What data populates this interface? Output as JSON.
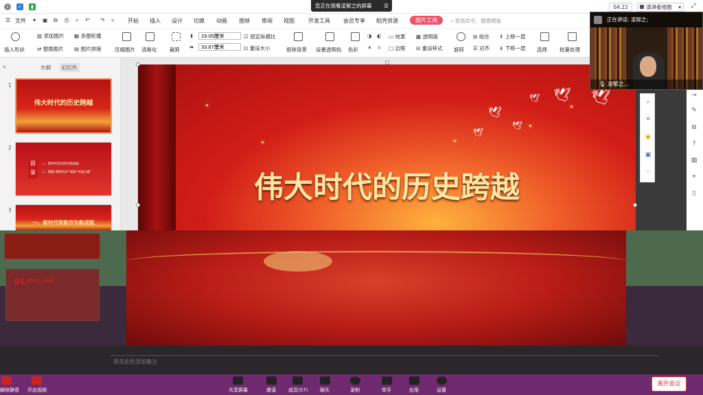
{
  "topbar": {
    "share_text": "您正在观看凌郁之的屏幕",
    "timer": "04:22",
    "presenter_view": "演讲者视图",
    "menu_icon": "menu-icon"
  },
  "menubar": {
    "file": "文件",
    "items": [
      "开始",
      "插入",
      "设计",
      "切换",
      "动画",
      "放映",
      "审阅",
      "视图",
      "开发工具",
      "会员专享",
      "稻壳资源"
    ],
    "active_tab": "图片工具",
    "search_placeholder": "查找命令、搜索模板"
  },
  "ribbon": {
    "insert_shape": "插入形状",
    "add_picture": "添加图片",
    "replace_picture": "替换图片",
    "multi_outline": "多图轮播",
    "picture_stitch": "图片拼接",
    "compress": "压缩图片",
    "sharpen": "清晰化",
    "crop": "裁剪",
    "height": "19.05厘米",
    "width": "33.87厘米",
    "lock_ratio": "锁定纵横比",
    "reset_size": "重设大小",
    "remove_bg": "抠除背景",
    "set_transparent": "设置透明色",
    "color": "色彩",
    "effects": "效果",
    "transparency": "透明度",
    "border": "边框",
    "reset_style": "重设样式",
    "rotate": "旋转",
    "group": "组合",
    "align": "对齐",
    "bring_forward": "上移一层",
    "send_backward": "下移一层",
    "select": "选择",
    "batch": "批量处理"
  },
  "leftpane": {
    "tab_outline": "大纲",
    "tab_slides": "幻灯片",
    "thumbs": [
      {
        "num": "1",
        "title": "伟大时代的历史跨越"
      },
      {
        "num": "2",
        "title": "目录",
        "lines": [
          "一、新时代在创作为新成就",
          "二、我国“两先先声”成就“中国之路”"
        ]
      },
      {
        "num": "3",
        "title": "一、新时代有新作为新成就"
      }
    ]
  },
  "slide": {
    "title": "伟大时代的历史跨越"
  },
  "video": {
    "speaking_prefix": "正在讲话: 凌郁之;",
    "name": "凌郁之..."
  },
  "glitch": {
    "section_num": "01",
    "section_title": "经济实力上新台阶",
    "meta_left": "单击此处添加备注"
  },
  "meetbar": {
    "mute": "解除静音",
    "video": "开启视频",
    "share": "共享屏幕",
    "invite": "邀请",
    "members": "成员(57)",
    "chat": "聊天",
    "record": "录制",
    "raise_hand": "举手",
    "apps": "应用",
    "settings": "设置",
    "leave": "离开会议"
  },
  "colors": {
    "accent_tab": "#f0526a",
    "leave": "#dd3333",
    "meetbar": "#6f2a6f"
  }
}
